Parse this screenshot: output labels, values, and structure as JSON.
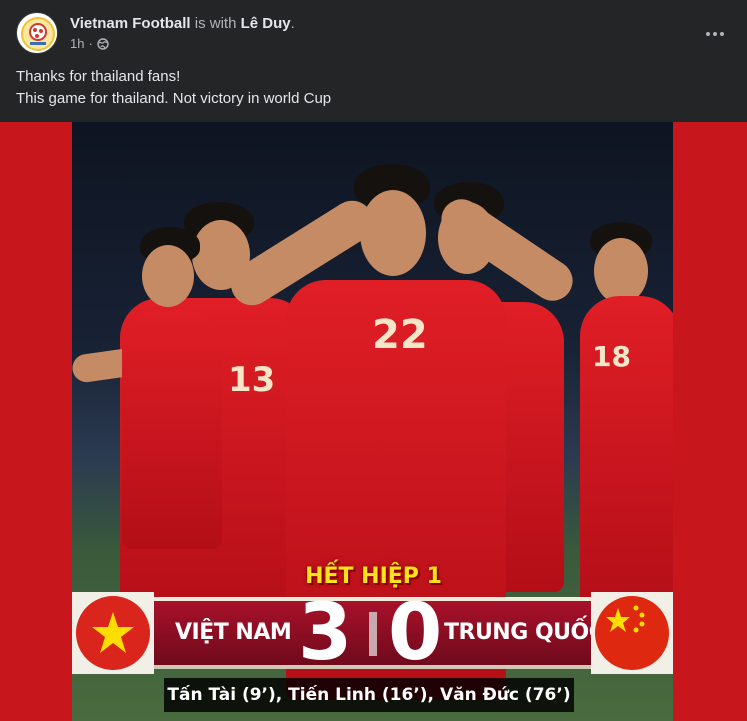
{
  "post": {
    "author": "Vietnam Football",
    "with_text": "is with",
    "tagged": "Lê Duy",
    "period": ".",
    "time": "1h",
    "separator": "·",
    "privacy_icon": "globe-icon",
    "more_icon": "more-horizontal-icon",
    "text_lines": [
      "Thanks for thailand fans!",
      "This game for thailand. Not victory in world Cup"
    ]
  },
  "image": {
    "title": "HẾT HIỆP 1",
    "home_team": "VIỆT NAM",
    "home_score": "3",
    "away_score": "0",
    "away_team": "TRUNG QUỐC",
    "scorers": "Tấn Tài (9’), Tiến Linh (16’), Văn Đức (76’)",
    "jersey_numbers": [
      "13",
      "22",
      "18"
    ],
    "colors": {
      "background_red": "#c8161d",
      "title_yellow": "#ffe21a",
      "score_panel": "#8f0e24",
      "vietnam_flag": "#da251d",
      "china_flag": "#de2910"
    }
  }
}
